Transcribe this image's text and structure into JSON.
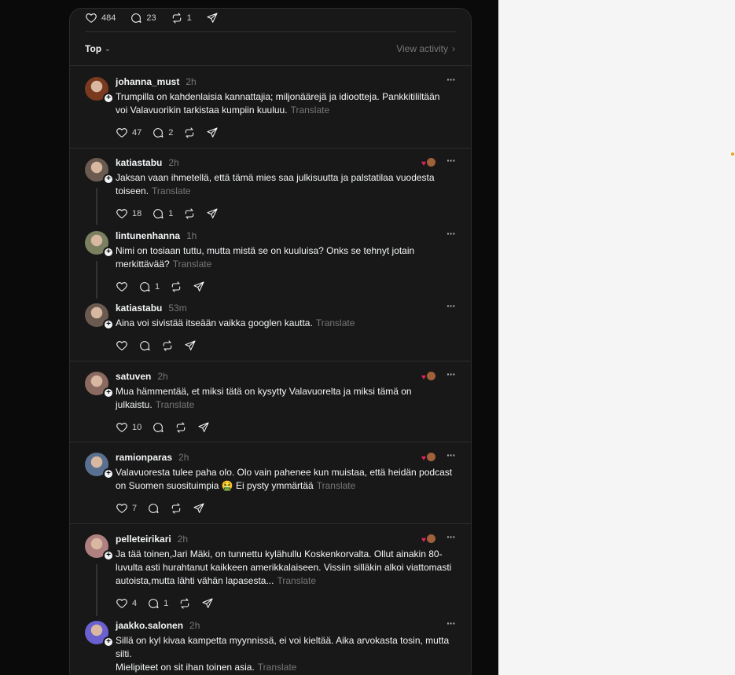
{
  "top_actions": {
    "likes": "484",
    "comments": "23",
    "reposts": "1"
  },
  "sort": {
    "label": "Top",
    "view_activity": "View activity"
  },
  "translate_label": "Translate",
  "posts": [
    {
      "user": "johanna_must",
      "time": "2h",
      "text": "Trumpilla on kahdenlaisia kannattajia; miljonäärejä ja idiootteja. Pankkitililtään voi Valavuorikin tarkistaa kumpiin kuuluu.",
      "likes": "47",
      "comments": "2",
      "reposts": "",
      "avatar_color": "#7a3a20"
    },
    {
      "user": "katiastabu",
      "time": "2h",
      "text": "Jaksan vaan ihmetellä, että tämä mies saa julkisuutta ja palstatilaa vuodesta toiseen.",
      "likes": "18",
      "comments": "1",
      "reposts": "",
      "avatar_color": "#6a5a50"
    },
    {
      "user": "lintunenhanna",
      "time": "1h",
      "text": "Nimi on tosiaan tuttu, mutta mistä se on kuuluisa? Onks se tehnyt jotain merkittävää?",
      "likes": "",
      "comments": "1",
      "reposts": "",
      "avatar_color": "#7a8060"
    },
    {
      "user": "katiastabu",
      "time": "53m",
      "text": "Aina voi sivistää itseään vaikka googlen kautta.",
      "likes": "",
      "comments": "",
      "reposts": "",
      "avatar_color": "#6a5a50"
    },
    {
      "user": "satuven",
      "time": "2h",
      "text": "Mua hämmentää, et miksi tätä on kysytty Valavuorelta ja miksi tämä on julkaistu.",
      "likes": "10",
      "comments": "",
      "reposts": "",
      "avatar_color": "#8a6a60"
    },
    {
      "user": "ramionparas",
      "time": "2h",
      "text": "Valavuoresta tulee paha olo. Olo vain pahenee kun muistaa, että heidän podcast on Suomen suosituimpia 🤮 Ei pysty ymmärtää",
      "likes": "7",
      "comments": "",
      "reposts": "",
      "avatar_color": "#5a7090"
    },
    {
      "user": "pelleteirikari",
      "time": "2h",
      "text": "Ja tää toinen,Jari Mäki, on tunnettu kylähullu Koskenkorvalta. Ollut ainakin 80-luvulta asti hurahtanut kaikkeen amerikkalaiseen. Vissiin silläkin alkoi viattomasti autoista,mutta lähti vähän lapasesta...",
      "likes": "4",
      "comments": "1",
      "reposts": "",
      "avatar_color": "#b08080"
    },
    {
      "user": "jaakko.salonen",
      "time": "2h",
      "text": "Sillä on kyl kivaa kampetta myynnissä, ei voi kieltää. Aika arvokasta tosin, mutta silti.",
      "text2": "Mielipiteet on sit ihan toinen asia.",
      "likes": "",
      "comments": "",
      "reposts": "",
      "avatar_color": "#6a60d0"
    }
  ],
  "colors": {
    "bg": "#0a0a0a",
    "panel": "#181818",
    "border": "#2d2d2d",
    "muted": "#777777",
    "heart": "#e0245e"
  }
}
